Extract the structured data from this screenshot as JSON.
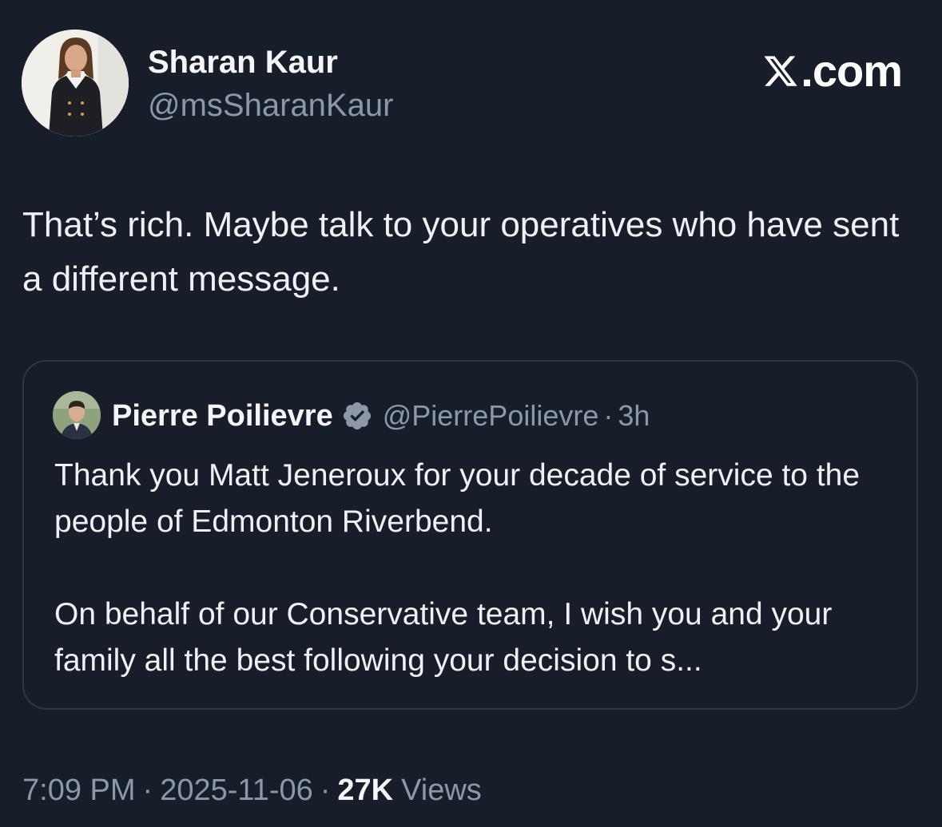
{
  "brand": {
    "label": ".com",
    "icon": "x-logo-icon"
  },
  "author": {
    "name": "Sharan Kaur",
    "handle": "@msSharanKaur",
    "avatar": "author-avatar"
  },
  "tweet": {
    "text": "That’s rich. Maybe talk to your operatives who have sent a different message."
  },
  "quote": {
    "name": "Pierre Poilievre",
    "verified_icon": "verified-badge-icon",
    "handle": "@PierrePoilievre",
    "dot": "·",
    "time": "3h",
    "paragraphs": [
      "Thank you Matt Jeneroux for your decade of service to the people of Edmonton Riverbend.",
      "On behalf of our Conservative team, I wish you and your family all the best following your decision to s..."
    ]
  },
  "meta": {
    "time": "7:09 PM",
    "sep": "·",
    "date": "2025-11-06",
    "views_count": "27K",
    "views_label": "Views"
  },
  "colors": {
    "background": "#171e29",
    "text_primary": "#eef1f4",
    "text_secondary": "#8b98a5",
    "card_border": "#2f3742"
  }
}
